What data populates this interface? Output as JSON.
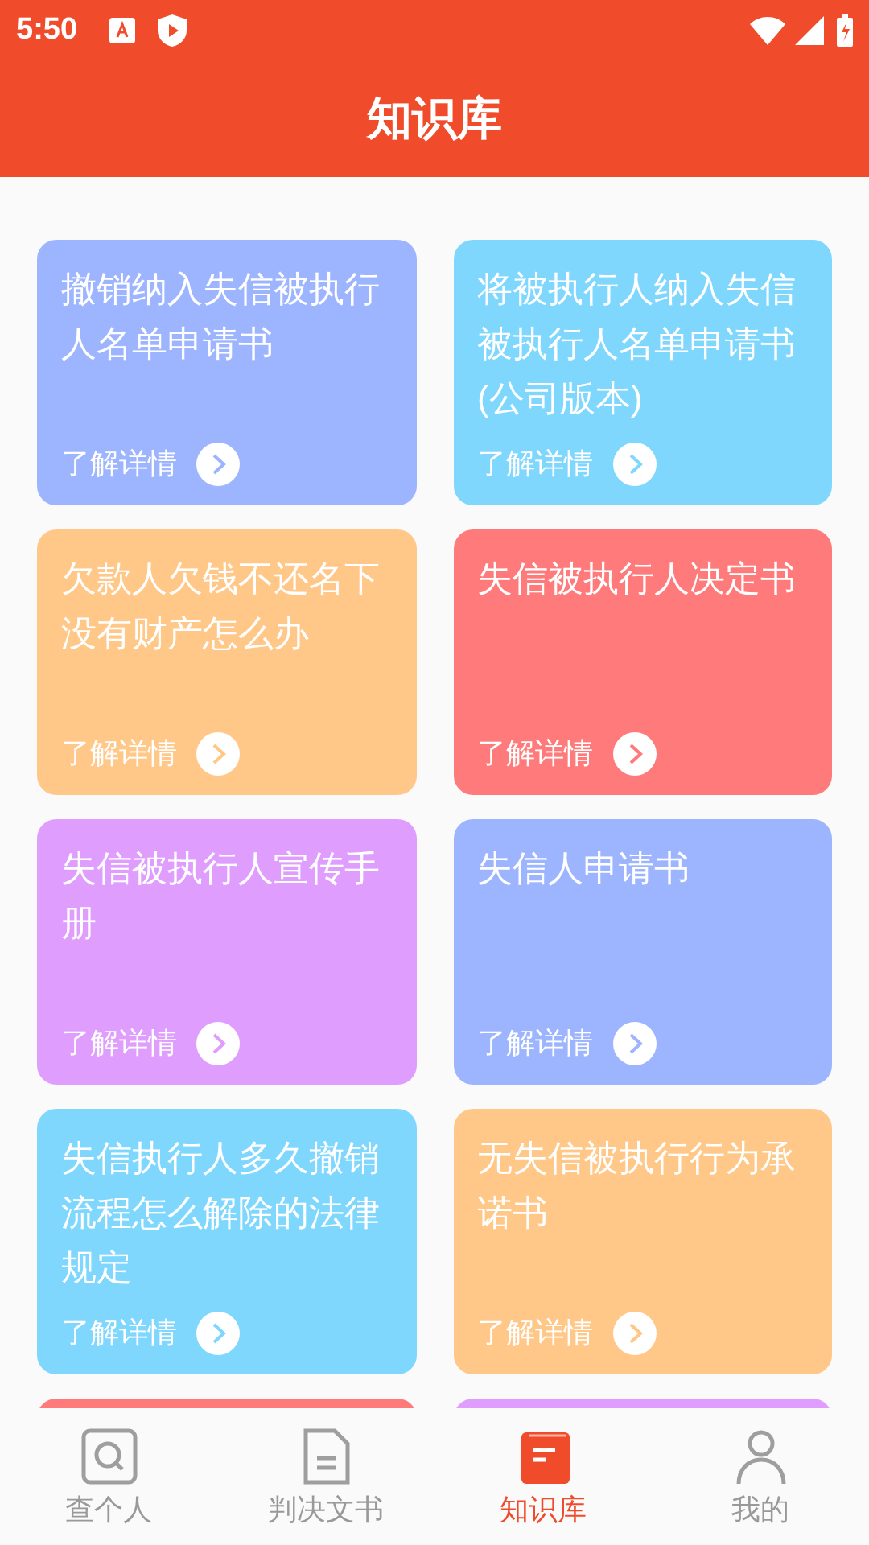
{
  "status_bar": {
    "time": "5:50"
  },
  "header": {
    "title": "知识库"
  },
  "cards": [
    {
      "title": "撤销纳入失信被执行人名单申请书",
      "link": "了解详情",
      "color": "#9db4ff"
    },
    {
      "title": "将被执行人纳入失信被执行人名单申请书(公司版本)",
      "link": "了解详情",
      "color": "#7fd7fe"
    },
    {
      "title": "欠款人欠钱不还名下没有财产怎么办",
      "link": "了解详情",
      "color": "#ffc888"
    },
    {
      "title": "失信被执行人决定书",
      "link": "了解详情",
      "color": "#ff7a7a"
    },
    {
      "title": "失信被执行人宣传手册",
      "link": "了解详情",
      "color": "#df9efd"
    },
    {
      "title": "失信人申请书",
      "link": "了解详情",
      "color": "#9db4ff"
    },
    {
      "title": "失信执行人多久撤销流程怎么解除的法律规定",
      "link": "了解详情",
      "color": "#7fd7fe"
    },
    {
      "title": "无失信被执行行为承诺书",
      "link": "了解详情",
      "color": "#ffc888"
    },
    {
      "color": "#ff7a7a"
    },
    {
      "color": "#df9efd"
    }
  ],
  "tabs": [
    {
      "label": "查个人",
      "kind": "search",
      "selected": false
    },
    {
      "label": "判决文书",
      "kind": "document",
      "selected": false
    },
    {
      "label": "知识库",
      "kind": "book",
      "selected": true
    },
    {
      "label": "我的",
      "kind": "person",
      "selected": false
    }
  ]
}
